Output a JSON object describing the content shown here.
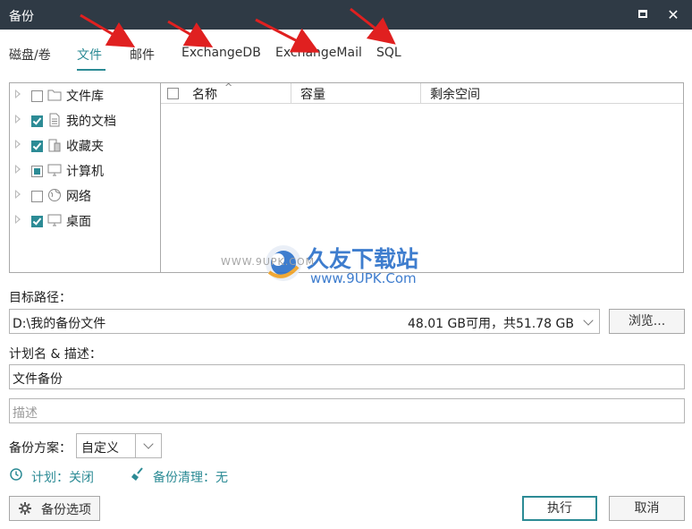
{
  "window": {
    "title": "备份"
  },
  "tabs": [
    {
      "label": "磁盘/卷",
      "active": false
    },
    {
      "label": "文件",
      "active": true
    },
    {
      "label": "邮件",
      "active": false
    },
    {
      "label": "ExchangeDB",
      "active": false
    },
    {
      "label": "ExchangeMail",
      "active": false
    },
    {
      "label": "SQL",
      "active": false
    }
  ],
  "tree": [
    {
      "label": "文件库",
      "checked": "unchecked",
      "icon": "folder-icon"
    },
    {
      "label": "我的文档",
      "checked": "checked",
      "icon": "document-icon"
    },
    {
      "label": "收藏夹",
      "checked": "checked",
      "icon": "favorites-icon"
    },
    {
      "label": "计算机",
      "checked": "partial",
      "icon": "computer-icon"
    },
    {
      "label": "网络",
      "checked": "unchecked",
      "icon": "network-icon"
    },
    {
      "label": "桌面",
      "checked": "checked",
      "icon": "desktop-icon"
    }
  ],
  "list": {
    "columns": [
      "名称",
      "容量",
      "剩余空间"
    ],
    "sort_indicator": "^"
  },
  "watermark": {
    "brand": "久友下载站",
    "url": "WWW.9UPK.COM",
    "url2": "www.9UPK.Com"
  },
  "destination": {
    "label": "目标路径：",
    "path": "D:\\我的备份文件",
    "space": "48.01 GB可用，共51.78 GB",
    "browse_label": "浏览..."
  },
  "plan": {
    "label": "计划名 & 描述：",
    "name": "文件备份",
    "description_placeholder": "描述"
  },
  "scheme": {
    "label": "备份方案：",
    "value": "自定义"
  },
  "schedule": {
    "label": "计划：关闭"
  },
  "cleanup": {
    "label": "备份清理：无"
  },
  "buttons": {
    "options": "备份选项",
    "execute": "执行",
    "cancel": "取消"
  },
  "colors": {
    "accent": "#2c8b95",
    "titlebar": "#2f3a45",
    "arrow": "#e02020"
  }
}
